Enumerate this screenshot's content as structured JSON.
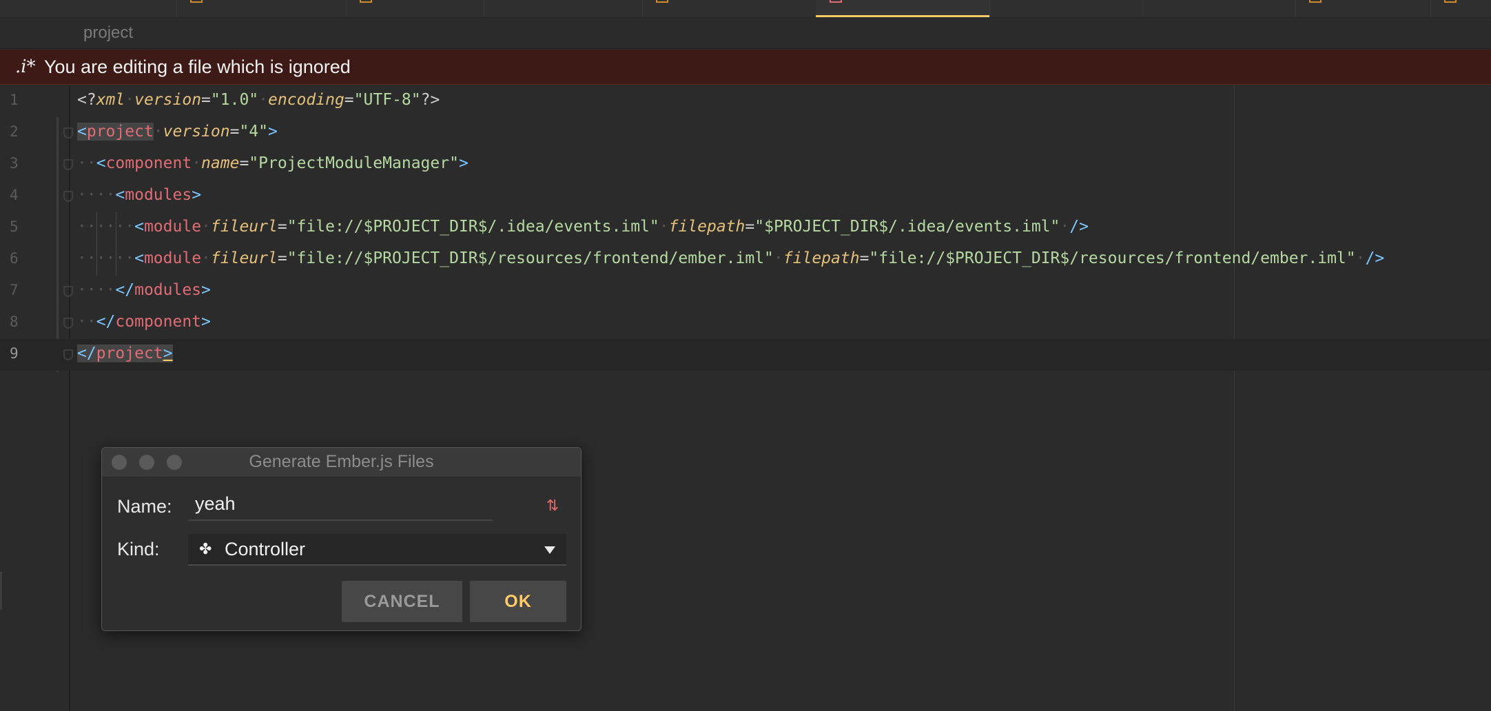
{
  "breadcrumb": {
    "label": "project"
  },
  "banner": {
    "icon_text": ".i*",
    "message": "You are editing a file which is ignored"
  },
  "editor": {
    "line_numbers": [
      "1",
      "2",
      "3",
      "4",
      "5",
      "6",
      "7",
      "8",
      "9"
    ],
    "lines": [
      "<?xml version=\"1.0\" encoding=\"UTF-8\"?>",
      "<project version=\"4\">",
      "  <component name=\"ProjectModuleManager\">",
      "    <modules>",
      "      <module fileurl=\"file://$PROJECT_DIR$/.idea/events.iml\" filepath=\"$PROJECT_DIR$/.idea/events.iml\" />",
      "      <module fileurl=\"file://$PROJECT_DIR$/resources/frontend/ember.iml\" filepath=\"file://$PROJECT_DIR$/resources/frontend/ember.iml\" />",
      "    </modules>",
      "  </component>",
      "</project>"
    ]
  },
  "dialog": {
    "title": "Generate Ember.js Files",
    "name_label": "Name:",
    "name_value": "yeah",
    "kind_label": "Kind:",
    "kind_value": "Controller",
    "kind_icon": "puzzle-icon",
    "swap_icon": "swap-icon",
    "cancel_label": "CANCEL",
    "ok_label": "OK"
  },
  "colors": {
    "accent": "#ffcc66",
    "tag": "#e06c75",
    "attribute": "#e5c07b",
    "string": "#b5d9a0",
    "bracket": "#7cc7ff",
    "banner_bg": "#3d1a15"
  }
}
